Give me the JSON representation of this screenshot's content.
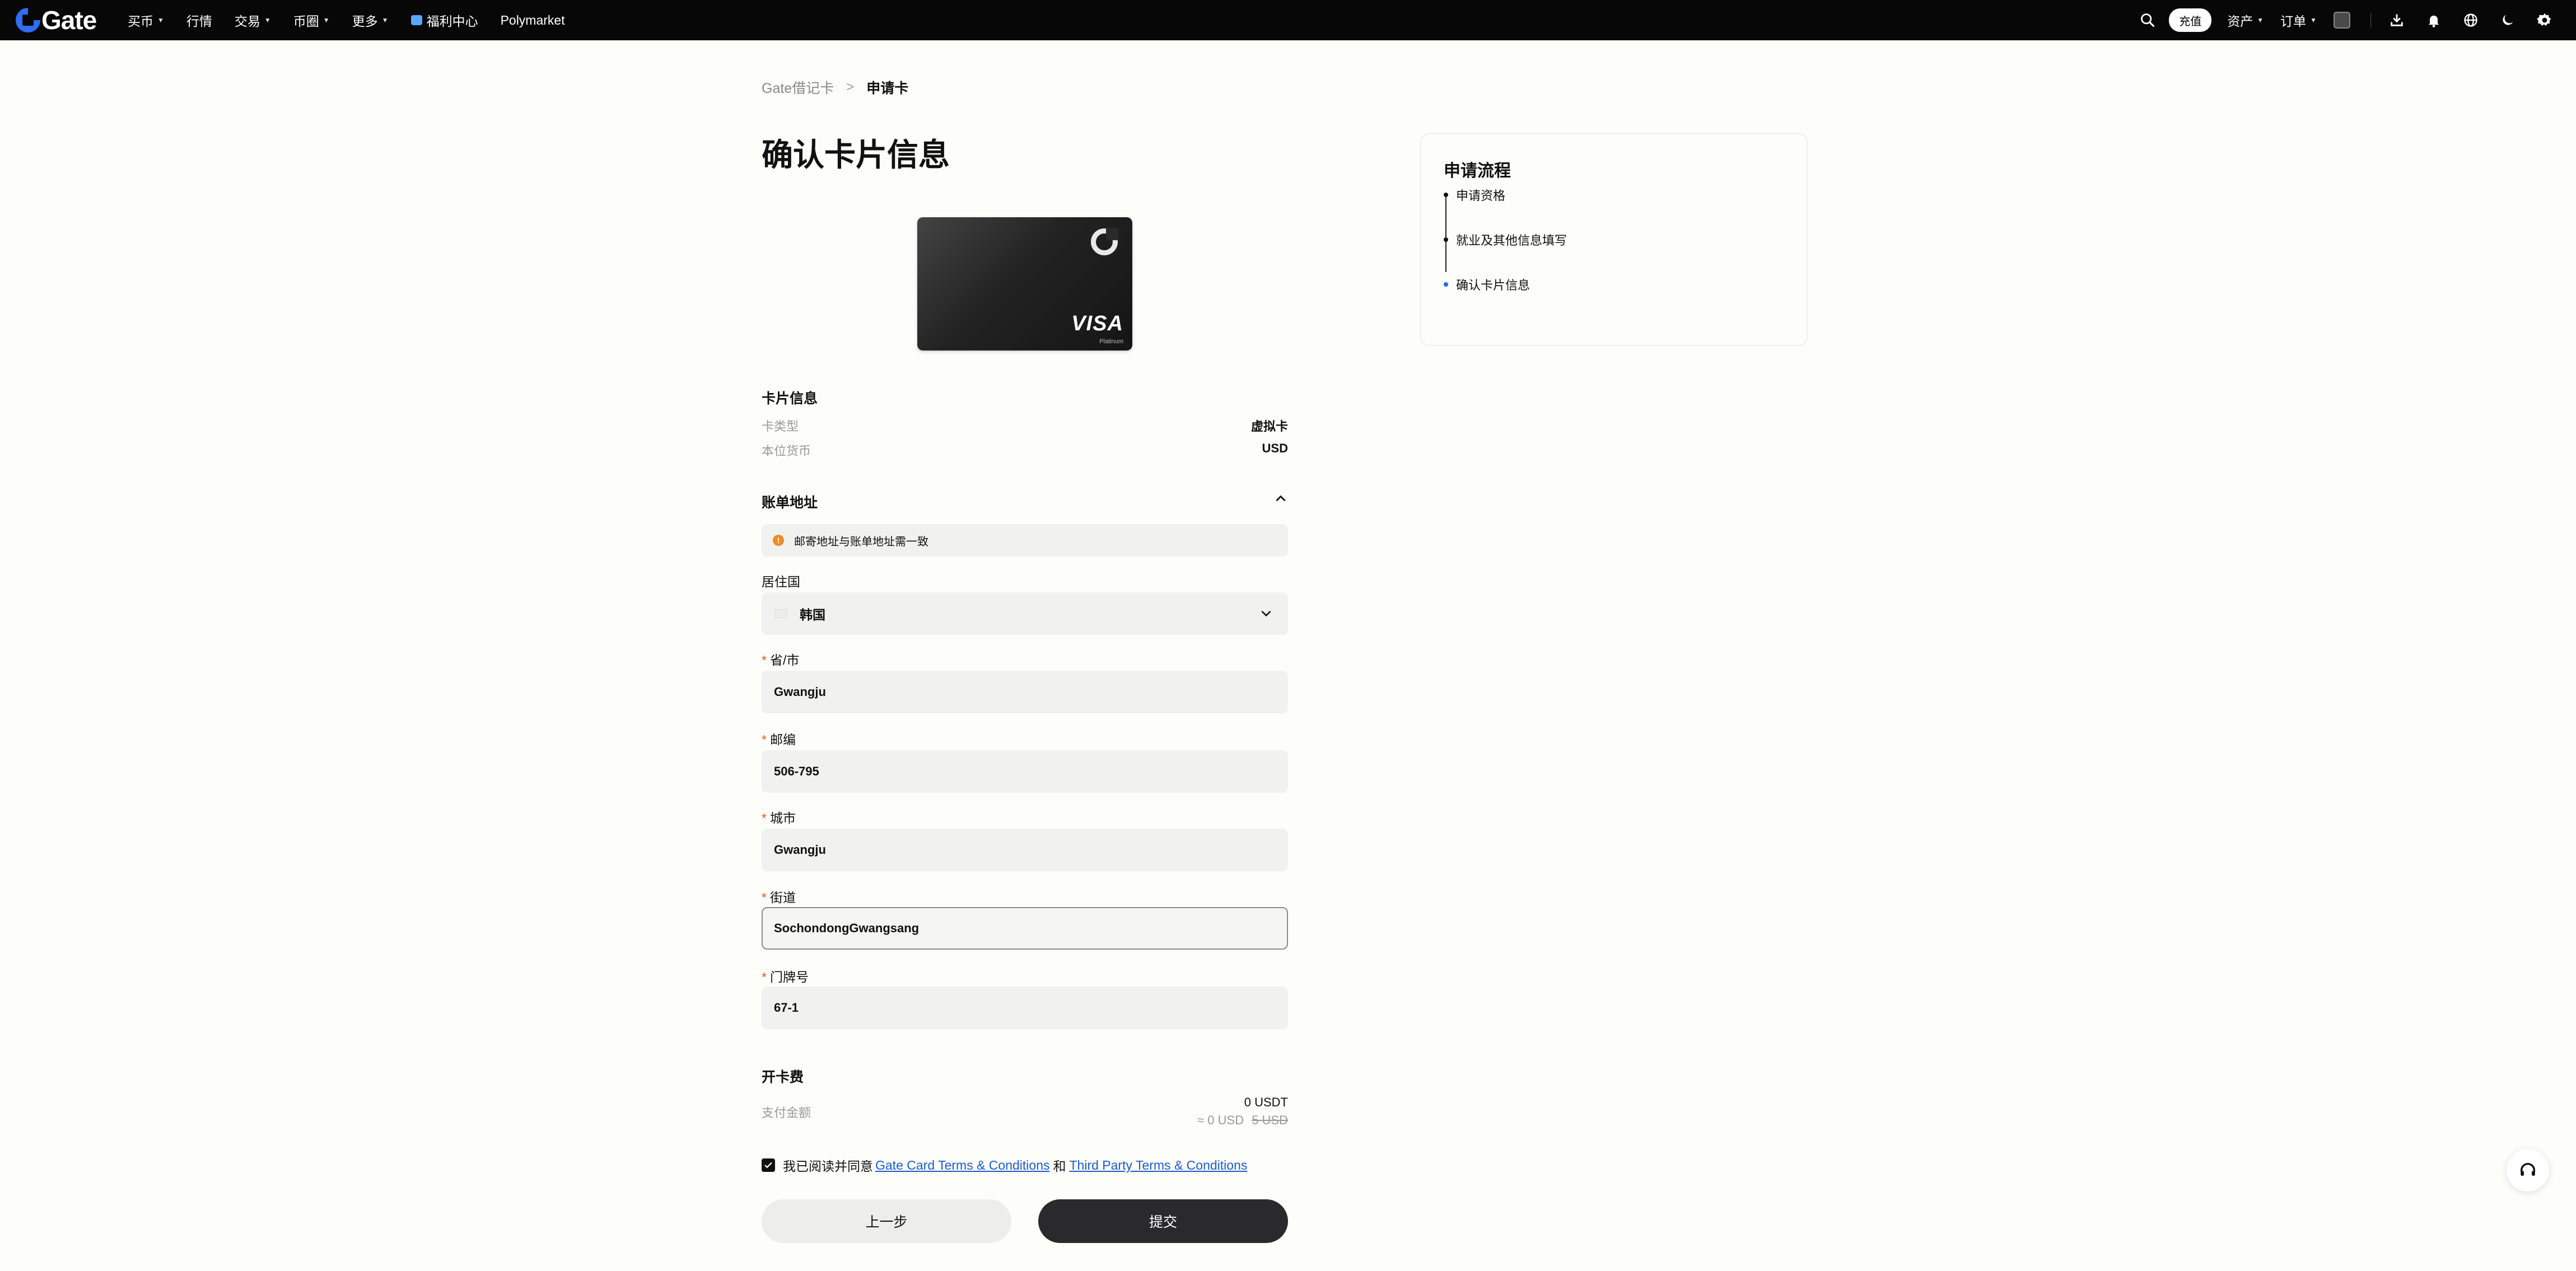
{
  "nav": {
    "logo": "Gate",
    "items": [
      {
        "label": "买币",
        "dropdown": true
      },
      {
        "label": "行情",
        "dropdown": false
      },
      {
        "label": "交易",
        "dropdown": true
      },
      {
        "label": "币圈",
        "dropdown": true
      },
      {
        "label": "更多",
        "dropdown": true
      },
      {
        "label": "福利中心",
        "dropdown": false
      },
      {
        "label": "Polymarket",
        "dropdown": false
      }
    ],
    "deposit_label": "充值",
    "assets_label": "资产",
    "orders_label": "订单"
  },
  "breadcrumb": {
    "parent": "Gate借记卡",
    "separator": ">",
    "current": "申请卡"
  },
  "page_title": "确认卡片信息",
  "card": {
    "brand": "VISA",
    "tier": "Platinum"
  },
  "card_info": {
    "title": "卡片信息",
    "rows": [
      {
        "label": "卡类型",
        "value": "虚拟卡"
      },
      {
        "label": "本位货币",
        "value": "USD"
      }
    ]
  },
  "billing": {
    "title": "账单地址",
    "notice": "邮寄地址与账单地址需一致",
    "country_label": "居住国",
    "country_value": "韩国",
    "fields": [
      {
        "label": "省/市",
        "value": "Gwangju"
      },
      {
        "label": "邮编",
        "value": "506-795"
      },
      {
        "label": "城市",
        "value": "Gwangju"
      },
      {
        "label": "街道",
        "value": "SochondongGwangsang"
      },
      {
        "label": "门牌号",
        "value": "67-1"
      }
    ]
  },
  "fee": {
    "title": "开卡费",
    "label": "支付金额",
    "amount": "0 USDT",
    "approx": "≈ 0 USD",
    "original": "5 USD"
  },
  "agreement": {
    "prefix": "我已阅读并同意",
    "link1": "Gate Card Terms & Conditions",
    "conj": "和",
    "link2": "Third Party Terms & Conditions"
  },
  "buttons": {
    "prev": "上一步",
    "submit": "提交"
  },
  "process": {
    "title": "申请流程",
    "steps": [
      "申请资格",
      "就业及其他信息填写",
      "确认卡片信息"
    ],
    "active_index": 2
  },
  "colors": {
    "accent_blue": "#1a6df0",
    "link": "#1a5bd6",
    "required": "#e2552b",
    "warning": "#f08a24"
  }
}
